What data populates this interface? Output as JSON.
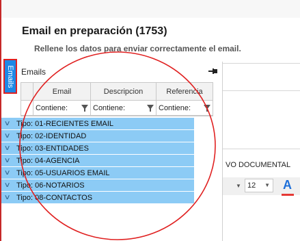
{
  "dialog": {
    "title": "Email en preparación (1753)",
    "subtitle": "Rellene los datos para enviar correctamente el email."
  },
  "side_tab": {
    "label": "Emails"
  },
  "panel": {
    "title": "Emails",
    "pin_icon": "pin-icon",
    "columns": [
      "Email",
      "Descripcion",
      "Referencia"
    ],
    "filters": [
      "Contiene:",
      "Contiene:",
      "Contiene:"
    ],
    "groups": [
      "Tipo: 01-RECIENTES EMAIL",
      "Tipo: 02-IDENTIDAD",
      "Tipo: 03-ENTIDADES",
      "Tipo: 04-AGENCIA",
      "Tipo: 05-USUARIOS EMAIL",
      "Tipo: 06-NOTARIOS",
      "Tipo: 08-CONTACTOS"
    ]
  },
  "right_area": {
    "label": "VO DOCUMENTAL",
    "font_size": "12",
    "font_color_icon": "font-color-icon"
  },
  "colors": {
    "group_row": "#8ccbf5",
    "side_tab": "#1e88e5",
    "annotation_red": "#e02020"
  }
}
